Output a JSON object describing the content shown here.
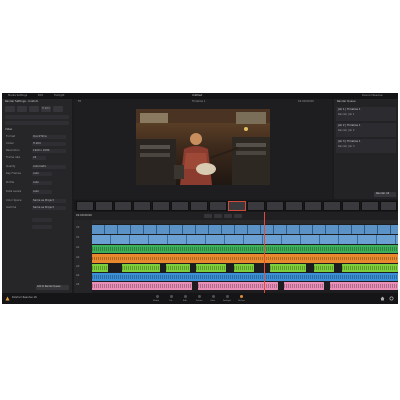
{
  "app": {
    "title": "Untitled"
  },
  "menubar": {
    "left": [
      "Media Settings",
      "Edit",
      "Fairlight"
    ],
    "right": "Davinci Resolve"
  },
  "left_panel": {
    "header": "Render Settings - Custom",
    "tabs": [
      "H.264",
      "Custom"
    ],
    "section": "Video",
    "fields": [
      {
        "label": "Format",
        "value": "QuickTime"
      },
      {
        "label": "Codec",
        "value": "H.264"
      },
      {
        "label": "Resolution",
        "value": "1920 x 1080"
      },
      {
        "label": "Frame rate",
        "value": "24"
      },
      {
        "label": "Quality",
        "value": "Automatic"
      },
      {
        "label": "Key Frames",
        "value": "Auto"
      },
      {
        "label": "Profile",
        "value": "Auto"
      },
      {
        "label": "Data Levels",
        "value": "Auto"
      },
      {
        "label": "Color Space",
        "value": "Same as Project"
      },
      {
        "label": "Gamma",
        "value": "Same as Project"
      }
    ],
    "add_button": "Add to Render Queue"
  },
  "viewer": {
    "timecode": "01:00:00:00",
    "zoom": "Fit",
    "clip_name": "Timeline 1"
  },
  "render_queue": {
    "title": "Render Queue",
    "jobs": [
      {
        "name": "Job 1 | Timeline 1",
        "status": "Render Job 1"
      },
      {
        "name": "Job 2 | Timeline 1",
        "status": "Render Job 2"
      },
      {
        "name": "Job 3 | Timeline 1",
        "status": "Render Job 3"
      }
    ],
    "render_button": "Render All"
  },
  "timeline": {
    "timecode": "01:00:00:00",
    "tracks": [
      "V2",
      "V1",
      "A1",
      "A2",
      "A3",
      "A4",
      "A5"
    ]
  },
  "bottom_bar": {
    "app_name": "DaVinci Resolve 16",
    "pages": [
      "Media",
      "Cut",
      "Edit",
      "Fusion",
      "Color",
      "Fairlight",
      "Deliver"
    ]
  },
  "colors": {
    "video": "#5b93c7",
    "audio_green": "#3fb05a",
    "audio_orange": "#e8892e",
    "audio_lime": "#7ccf3a",
    "audio_blue": "#3a8fd6",
    "audio_pink": "#e98fb8",
    "playhead": "#e04b3c"
  },
  "icons": [
    "resolve-logo-icon",
    "home-icon",
    "settings-icon",
    "play-icon",
    "stop-icon",
    "skip-back-icon",
    "skip-forward-icon"
  ]
}
